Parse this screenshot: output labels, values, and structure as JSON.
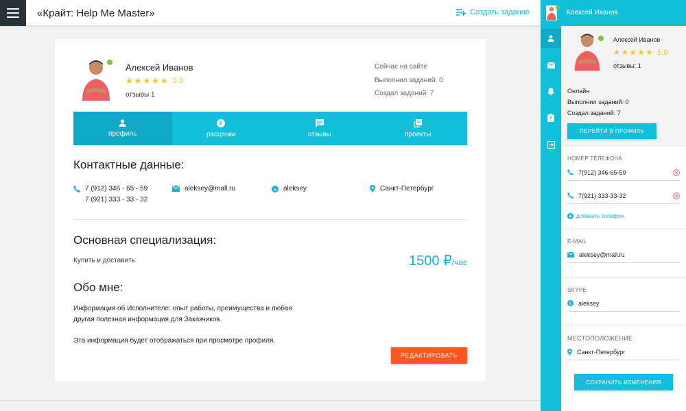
{
  "topbar": {
    "title": "«Крайт: Help Me Master»",
    "create_task": "Создать задание"
  },
  "profile": {
    "name": "Алексей Иванов",
    "rating": "5.0",
    "reviews": "отзывы 1",
    "status_online": "Сейчас на сайте",
    "tasks_done": "Выполнил заданий: 0",
    "tasks_created": "Создал заданий: 7"
  },
  "tabs": [
    {
      "label": "профиль",
      "icon": "person-icon"
    },
    {
      "label": "расценки",
      "icon": "ruble-icon"
    },
    {
      "label": "отзывы",
      "icon": "comment-icon"
    },
    {
      "label": "проекты",
      "icon": "library-icon"
    }
  ],
  "contacts": {
    "title": "Контактные данные:",
    "phone1": "7 (912) 346 - 65 - 59",
    "phone2": "7 (921) 333 - 33 - 32",
    "email": "aleksey@mall.ru",
    "skype": "aleksey",
    "location": "Санкт-Петербург"
  },
  "specialization": {
    "title": "Основная специализация:",
    "text": "Купить и доставить",
    "price": "1500 ₽",
    "price_unit": "/час"
  },
  "about": {
    "title": "Обо мне:",
    "line1": "Информация об Исполнителе: опыт работы, преимущества и любая",
    "line2": "другая полезная информация для Заказчиков.",
    "line3": "Эта информация будет отображаться при просмотре профиля."
  },
  "edit_button": "РЕДАКТИРОВАТЬ",
  "panel": {
    "header_name": "Алексей Иванов",
    "name": "Алексей Иванов",
    "rating": "5.0",
    "reviews": "отзывы: 1",
    "online": "Онлайн",
    "tasks_done": "Выполнил заданий: 0",
    "tasks_created": "Создал заданий: 7",
    "profile_button": "ПЕРЕЙТИ В ПРОФИЛЬ",
    "phone_label": "НОМЕР ТЕЛЕФОНА",
    "phone1": "7(912) 346-65-59",
    "phone2": "7(921) 333-33-32",
    "add_phone": "добавить телефон",
    "email_label": "E-MAIL",
    "email": "aleksey@mall.ru",
    "skype_label": "SKYPE",
    "skype": "aleksey",
    "location_label": "МЕСТОПОЛОЖЕНИЕ",
    "location": "Санкт-Петербург",
    "save_button": "СОХРАНИТЬ ИЗМЕНЕНИЯ"
  },
  "colors": {
    "accent": "#12bfda",
    "accent_dark": "#10a9c5",
    "edit_button": "#ff5722",
    "star": "#f8c21c",
    "online": "#7cc142"
  }
}
